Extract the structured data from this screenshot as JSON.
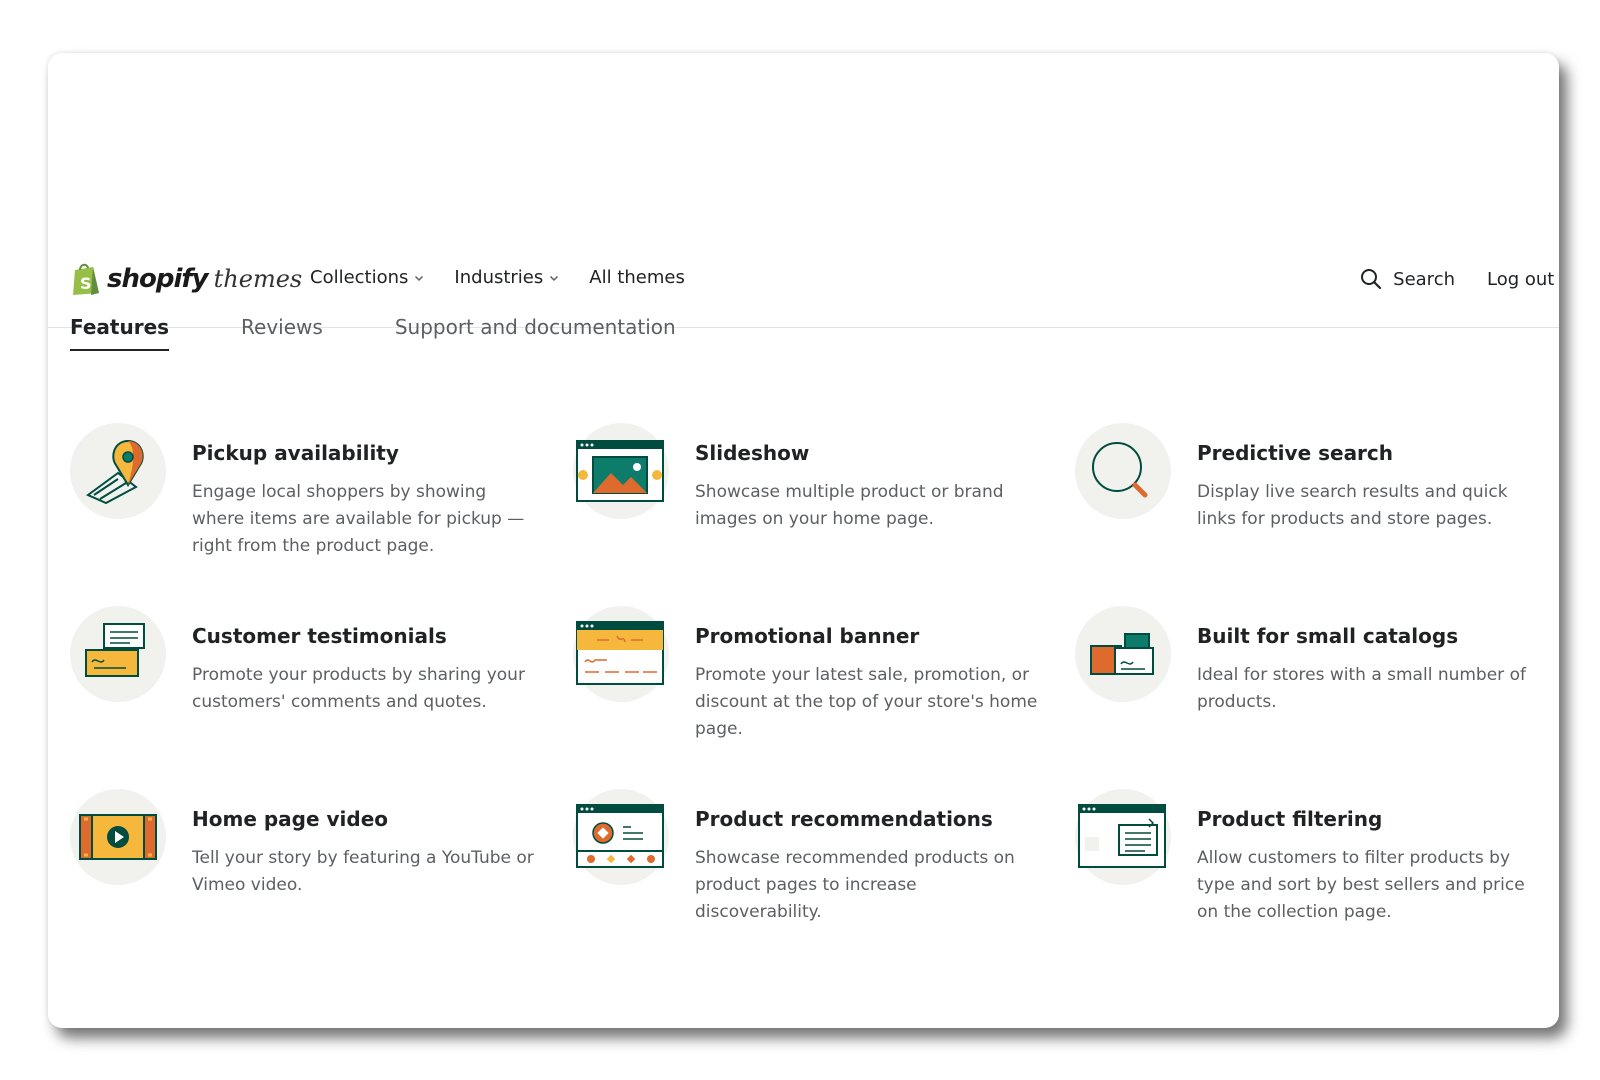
{
  "brand": {
    "name": "shopify",
    "sub": "themes"
  },
  "nav": {
    "items": [
      {
        "label": "Collections",
        "dropdown": true
      },
      {
        "label": "Industries",
        "dropdown": true
      },
      {
        "label": "All themes",
        "dropdown": false
      }
    ],
    "search_label": "Search",
    "logout_label": "Log out"
  },
  "tabs": [
    {
      "label": "Features",
      "active": true
    },
    {
      "label": "Reviews",
      "active": false
    },
    {
      "label": "Support and documentation",
      "active": false
    }
  ],
  "features": [
    {
      "icon": "pickup-availability-icon",
      "title": "Pickup availability",
      "desc": "Engage local shoppers by showing where items are available for pickup — right from the product page."
    },
    {
      "icon": "slideshow-icon",
      "title": "Slideshow",
      "desc": "Showcase multiple product or brand images on your home page."
    },
    {
      "icon": "predictive-search-icon",
      "title": "Predictive search",
      "desc": "Display live search results and quick links for products and store pages."
    },
    {
      "icon": "customer-testimonials-icon",
      "title": "Customer testimonials",
      "desc": "Promote your products by sharing your customers' comments and quotes."
    },
    {
      "icon": "promotional-banner-icon",
      "title": "Promotional banner",
      "desc": "Promote your latest sale, promotion, or discount at the top of your store's home page."
    },
    {
      "icon": "small-catalogs-icon",
      "title": "Built for small catalogs",
      "desc": "Ideal for stores with a small number of products."
    },
    {
      "icon": "home-page-video-icon",
      "title": "Home page video",
      "desc": "Tell your story by featuring a YouTube or Vimeo video."
    },
    {
      "icon": "product-recommendations-icon",
      "title": "Product recommendations",
      "desc": "Showcase recommended products on product pages to increase discoverability."
    },
    {
      "icon": "product-filtering-icon",
      "title": "Product filtering",
      "desc": "Allow customers to filter products by type and sort by best sellers and price on the collection page."
    }
  ],
  "colors": {
    "teal": "#004c3f",
    "orange": "#de6a2e",
    "yellow": "#f5b83d",
    "green": "#95bf47",
    "bubble": "#f1f1ee"
  }
}
